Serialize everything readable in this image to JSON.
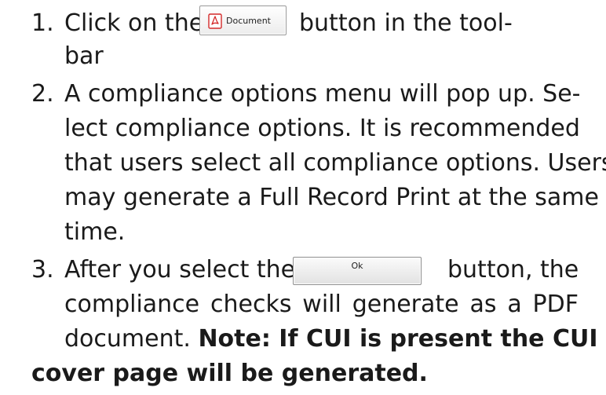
{
  "steps": [
    {
      "number": "1.",
      "before_button": "Click on the",
      "button_label": "Document",
      "button_icon": "pdf-icon",
      "after_button": "button in the tool-",
      "continuation": "bar"
    },
    {
      "number": "2.",
      "lines": [
        "A compliance options menu will pop up. Se-",
        "lect compliance options. It is recommended",
        "that users select all compliance options. Users",
        "may generate a Full Record Print at the same",
        "time."
      ]
    },
    {
      "number": "3.",
      "before_button": "After you select the",
      "button_label": "Ok",
      "after_button": "button, the",
      "lines": [
        "compliance checks will generate as a PDF",
        "document."
      ],
      "note_part1": "Note: If CUI is present the CUI",
      "note_part2": "cover page will be generated."
    }
  ],
  "colors": {
    "text": "#1a1a1a",
    "pdf_icon": "#d42a2a",
    "button_border": "#9a9a9a"
  }
}
